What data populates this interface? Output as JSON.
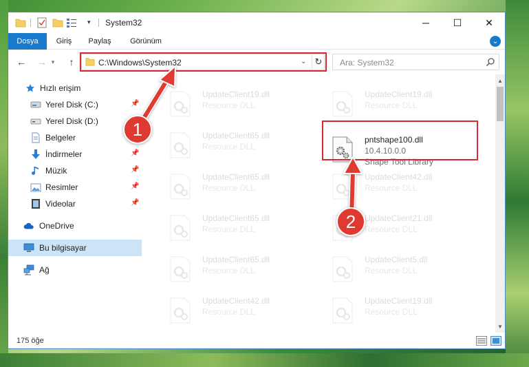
{
  "window": {
    "title": "System32",
    "controls": {
      "minimize": "─",
      "maximize": "☐",
      "close": "✕"
    }
  },
  "ribbon": {
    "tabs": [
      "Dosya",
      "Giriş",
      "Paylaş",
      "Görünüm"
    ],
    "expand_icon": "chevron-down-icon"
  },
  "address_bar": {
    "path": "C:\\Windows\\System32",
    "search_placeholder": "Ara: System32"
  },
  "sidebar": {
    "quick_access": "Hızlı erişim",
    "items": [
      {
        "label": "Yerel Disk (C:)",
        "icon": "drive-icon",
        "pinned": true
      },
      {
        "label": "Yerel Disk (D:)",
        "icon": "drive-icon",
        "pinned": false
      },
      {
        "label": "Belgeler",
        "icon": "documents-icon",
        "pinned": true
      },
      {
        "label": "İndirmeler",
        "icon": "download-icon",
        "pinned": true
      },
      {
        "label": "Müzik",
        "icon": "music-icon",
        "pinned": true
      },
      {
        "label": "Resimler",
        "icon": "pictures-icon",
        "pinned": true
      },
      {
        "label": "Videolar",
        "icon": "video-icon",
        "pinned": true
      }
    ],
    "onedrive": "OneDrive",
    "this_pc": "Bu bilgisayar",
    "network": "Ağ"
  },
  "files": {
    "left_column": [
      {
        "name": "UpdateClient19.dll",
        "type": "Resource DLL"
      },
      {
        "name": "UpdateClient65.dll",
        "type": "Resource DLL"
      },
      {
        "name": "UpdateClient65.dll",
        "type": "Resource DLL"
      },
      {
        "name": "UpdateClient65.dll",
        "type": "Resource DLL"
      },
      {
        "name": "UpdateClient65.dll",
        "type": "Resource DLL"
      },
      {
        "name": "UpdateClient42.dll",
        "type": "Resource DLL"
      }
    ],
    "right_column": [
      {
        "name": "UpdateClient19.dll",
        "type": "Resource DLL"
      },
      {
        "name": "pntshape100.dll",
        "version": "10.4.10.0.0",
        "type": "Shape Tool Library",
        "highlighted": true
      },
      {
        "name": "UpdateClient42.dll",
        "type": "Resource DLL"
      },
      {
        "name": "UpdateClient21.dll",
        "type": "Resource DLL"
      },
      {
        "name": "UpdateClient5.dll",
        "type": "Resource DLL"
      },
      {
        "name": "UpdateClient19.dll",
        "type": "Resource DLL"
      }
    ]
  },
  "status_bar": {
    "item_count": "175 öğe"
  },
  "annotations": {
    "step1": "1",
    "step2": "2",
    "color": "#df3a31"
  }
}
